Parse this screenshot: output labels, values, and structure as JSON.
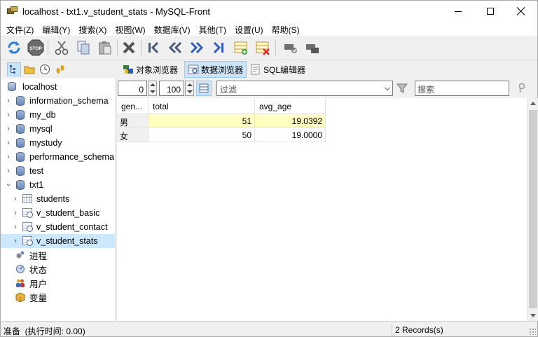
{
  "window": {
    "title": "localhost - txt1.v_student_stats - MySQL-Front"
  },
  "menu": [
    "文件(Z)",
    "编辑(Y)",
    "搜索(X)",
    "视图(W)",
    "数据库(V)",
    "其他(T)",
    "设置(U)",
    "帮助(S)"
  ],
  "toolbar": {
    "buttons": [
      "refresh-icon",
      "stop-icon",
      "cut-icon",
      "copy-icon",
      "paste-icon",
      "delete-icon",
      "first-record-icon",
      "previous-page-icon",
      "next-page-icon",
      "last-record-icon",
      "insert-record-icon",
      "delete-record-icon",
      "post-icon",
      "cancel-icon"
    ]
  },
  "view_tabs": {
    "object_browser": "对象浏览器",
    "data_browser": "数据浏览器",
    "sql_editor": "SQL编辑器"
  },
  "tree": {
    "root": "localhost",
    "databases": [
      "information_schema",
      "my_db",
      "mysql",
      "mystudy",
      "performance_schema",
      "test",
      "txt1"
    ],
    "txt1_children": [
      "students",
      "v_student_basic",
      "v_student_contact",
      "v_student_stats"
    ],
    "selected": "v_student_stats",
    "extras": [
      "进程",
      "状态",
      "用户",
      "变量"
    ]
  },
  "data_toolbar": {
    "offset": "0",
    "limit": "100",
    "filter_placeholder": "过滤",
    "search_placeholder": "搜索"
  },
  "grid": {
    "columns": [
      "gen...",
      "total",
      "avg_age"
    ],
    "rows": [
      [
        "男",
        "51",
        "19.0392"
      ],
      [
        "女",
        "50",
        "19.0000"
      ]
    ]
  },
  "status": {
    "left": "准备  (执行时间: 0.00)",
    "right": "2 Records(s)"
  },
  "colors": {
    "selection": "#cce8ff",
    "highlight_cell": "#ffffc0",
    "accent": "#3b5fa6"
  }
}
